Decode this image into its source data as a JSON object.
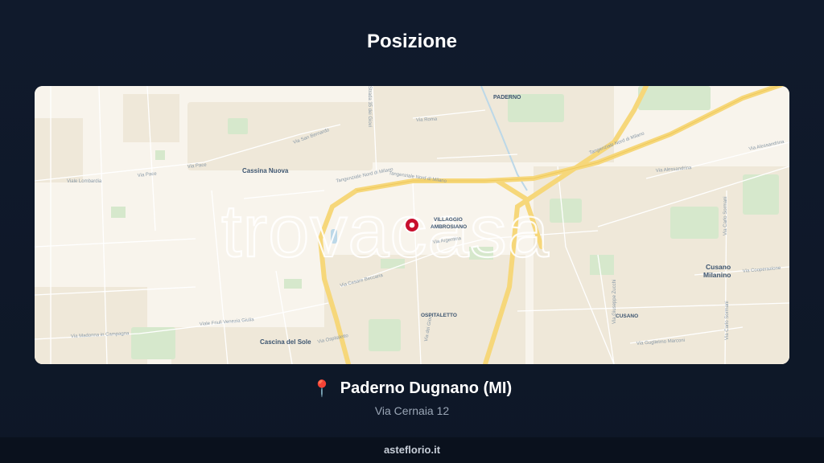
{
  "header": {
    "title": "Posizione"
  },
  "map": {
    "watermark": "trovacasa",
    "places": {
      "paderno": "PADERNO",
      "cassina_nuova": "Cassina Nuova",
      "villaggio": "VILLAGGIO",
      "ambrosiano": "AMBROSIANO",
      "ospitaletto": "OSPITALETTO",
      "cusano": "CUSANO",
      "cusano_milanino_1": "Cusano",
      "cusano_milanino_2": "Milanino",
      "cascina_del_sole": "Cascina del Sole"
    },
    "streets": {
      "tangenziale_1": "Tangenziale Nord di Milano",
      "tangenziale_2": "Tangenziale Nord di Milano",
      "tangenziale_3": "Tangenziale Nord di Milano",
      "via_roma": "Via Roma",
      "via_san_bernardo": "Via San Bernardo",
      "via_pace_1": "Via Pace",
      "via_pace_2": "Via Pace",
      "viale_lombardia": "Viale Lombardia",
      "via_argentina": "Via Argentina",
      "via_cesare_beccaria": "Via Cesare Beccaria",
      "viale_friuli": "Viale Friuli Venezia Giulia",
      "via_madonna": "Via Madonna in Campagna",
      "via_alessandrina_1": "Via Alessandrina",
      "via_alessandrina_2": "Via Alessandrina",
      "via_carlo_sormani_1": "Via Carlo Sormani",
      "via_carlo_sormani_2": "Via Carlo Sormani",
      "via_cooperazione": "Via Cooperazione",
      "via_guglielmo_marconi": "Via Guglielmo Marconi",
      "via_giuseppe_zucchi": "Via Giuseppe Zucchi",
      "strada_35": "Strada 35 dei Giovi",
      "via_dei_giovi": "Via dei Giovi",
      "via_ospitaletto": "Via Ospitaletto"
    },
    "marker": "location-marker"
  },
  "location": {
    "pin_icon": "📍",
    "city": "Paderno Dugnano (MI)",
    "address": "Via Cernaia 12"
  },
  "footer": {
    "brand": "asteflorio.it"
  },
  "colors": {
    "background": "#101a2c",
    "map_base": "#f8f4ec",
    "highway": "#f6d77a",
    "park": "#cfe6c4",
    "marker": "#c8102e"
  }
}
